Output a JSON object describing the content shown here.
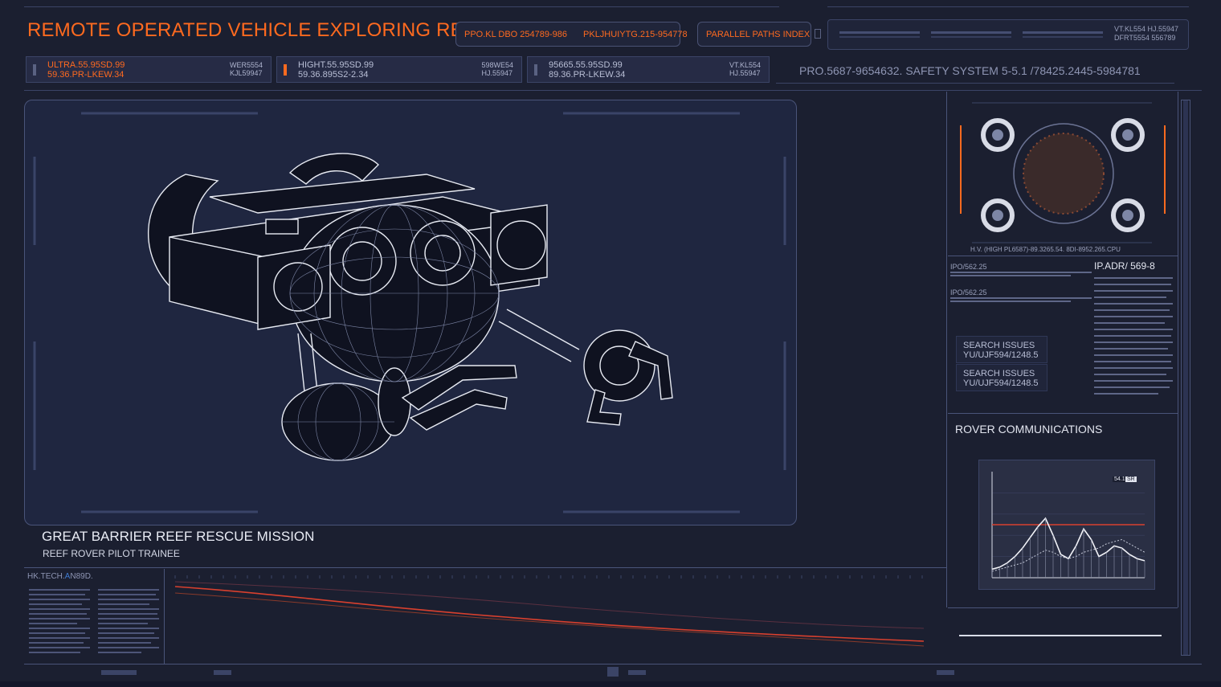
{
  "header": {
    "title": "REMOTE OPERATED  VEHICLE EXPLORING REEFS",
    "pill_a": "PPO.KL DBO 254789-986",
    "pill_b": "PKLJHUIYTG.215-954778",
    "pill_c": "PARALLEL PATHS INDEX",
    "corner_line1": "VT.KL554 HJ.55947",
    "corner_line2": "DFRT5554 556789"
  },
  "databar": [
    {
      "left_line1": "ULTRA.55.95SD.99",
      "left_line2": "59.36.PR-LKEW.34",
      "right_line1": "WER5554",
      "right_line2": "KJL59947"
    },
    {
      "left_line1": "HIGHT.55.95SD.99",
      "left_line2": "59.36.895S2-2.34",
      "right_line1": "598WE54",
      "right_line2": "HJ.55947"
    },
    {
      "left_line1": "95665.55.95SD.99",
      "left_line2": "89.36.PR-LKEW.34",
      "right_line1": "VT.KL554",
      "right_line2": "HJ.55947"
    }
  ],
  "safety_text": "PRO.5687-9654632. SAFETY SYSTEM 5-5.1 /78425.2445-5984781",
  "mission": {
    "title": "GREAT BARRIER REEF RESCUE MISSION",
    "subtitle": "REEF ROVER PILOT TRAINEE"
  },
  "right_panel": {
    "dial_caption": "H.V. (HIGH PL6587)-89.3265.54. 8DI-8952.265.CPU",
    "ipo_1": "IPO/562.25",
    "ipo_2": "IPO/562.25",
    "ipadr": "IP.ADR/ 569-8",
    "search_1_line1": "SEARCH ISSUES",
    "search_1_line2": "YU/UJF594/1248.5",
    "search_2_line1": "SEARCH ISSUES",
    "search_2_line2": "YU/UJF594/1248.5",
    "comms_title": "ROVER COMMUNICATIONS",
    "chart_badge_a": "54.1",
    "chart_badge_b": "SR"
  },
  "bottom": {
    "hk_label_a": "HK.TECH.",
    "hk_label_b": "A",
    "hk_label_c": "N89D."
  },
  "colors": {
    "accent_orange": "#ff6a1f",
    "panel_border": "#3f4870",
    "background": "#1b1f30",
    "graph_red": "#d8402e"
  },
  "chart_data": {
    "type": "line",
    "title": "",
    "x": [
      0,
      5,
      10,
      15,
      20,
      25,
      30,
      35,
      40,
      45,
      50,
      55,
      60,
      65,
      70,
      75,
      80,
      85,
      90,
      95,
      100
    ],
    "series": [
      {
        "values": [
          8,
          10,
          14,
          20,
          28,
          38,
          48,
          56,
          40,
          22,
          18,
          30,
          46,
          36,
          20,
          24,
          30,
          28,
          22,
          18,
          16
        ]
      },
      {
        "values": [
          6,
          8,
          10,
          12,
          14,
          18,
          22,
          26,
          24,
          20,
          18,
          20,
          24,
          26,
          28,
          32,
          34,
          36,
          32,
          28,
          24
        ]
      }
    ],
    "threshold": 50,
    "ylim": [
      0,
      100
    ],
    "xlabel": "",
    "ylabel": "",
    "grid": true
  }
}
